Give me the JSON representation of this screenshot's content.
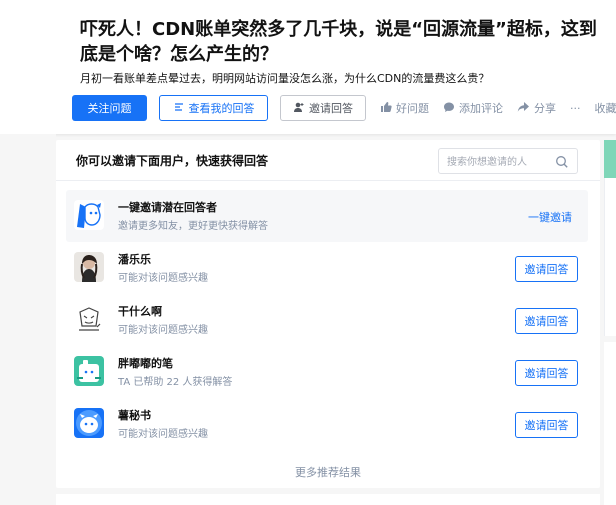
{
  "question": {
    "title": "吓死人！CDN账单突然多了几千块，说是“回源流量”超标，这到底是个啥？怎么产生的？",
    "excerpt": "月初一看账单差点晕过去，明明网站访问量没怎么涨，为什么CDN的流量费这么贵？"
  },
  "toolbar": {
    "follow_label": "关注问题",
    "my_answer_label": "查看我的回答",
    "invite_label": "邀请回答",
    "good_question_label": "好问题",
    "comment_label": "添加评论",
    "share_label": "分享",
    "more_label": "···",
    "collect_label": "收藏"
  },
  "invite_panel": {
    "title": "你可以邀请下面用户，快速获得回答",
    "search_placeholder": "搜索你想邀请的人",
    "users": [
      {
        "name": "一键邀请潜在回答者",
        "desc": "邀请更多知友，更好更快获得解答",
        "action": "一键邀请"
      },
      {
        "name": "潘乐乐",
        "desc": "可能对该问题感兴趣",
        "action": "邀请回答"
      },
      {
        "name": "干什么啊",
        "desc": "可能对该问题感兴趣",
        "action": "邀请回答"
      },
      {
        "name": "胖嘟嘟的笔",
        "desc": "TA 已帮助 22 人获得解答",
        "action": "邀请回答"
      },
      {
        "name": "薯秘书",
        "desc": "可能对该问题感兴趣",
        "action": "邀请回答"
      }
    ],
    "more_label": "更多推荐结果"
  },
  "colors": {
    "accent": "#1772f6",
    "muted": "#8491a5"
  }
}
